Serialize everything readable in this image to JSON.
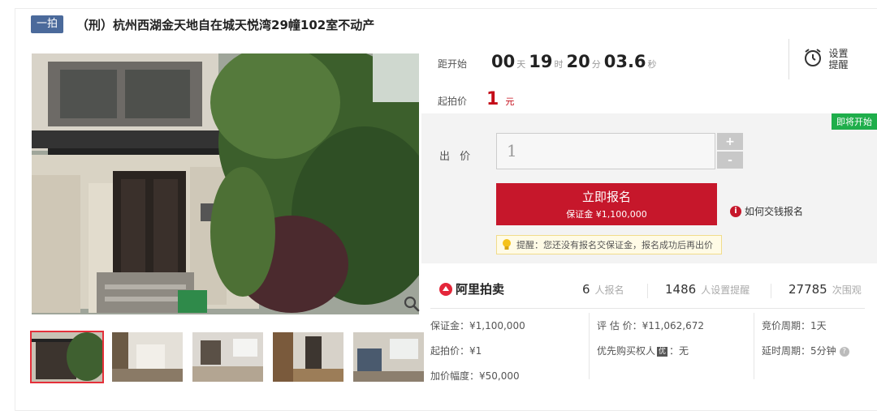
{
  "header": {
    "round_badge": "一拍",
    "title": "（刑）杭州西湖金天地自在城天悦湾29幢102室不动产"
  },
  "countdown": {
    "label": "距开始",
    "days": "00",
    "days_unit": "天",
    "hours": "19",
    "hours_unit": "时",
    "minutes": "20",
    "minutes_unit": "分",
    "seconds": "03.6",
    "seconds_unit": "秒"
  },
  "start_price": {
    "label": "起拍价",
    "value": "1",
    "unit": "元"
  },
  "reminder": {
    "line1": "设置",
    "line2": "提醒"
  },
  "bid": {
    "status_badge": "即将开始",
    "label": "出 价",
    "input_value": "1",
    "plus": "+",
    "minus": "-",
    "signup_label": "立即报名",
    "deposit_line": "保证金 ¥1,100,000",
    "howto_label": "如何交钱报名",
    "tip": "提醒：您还没有报名交保证金，报名成功后再出价"
  },
  "stats": {
    "logo_text": "阿里拍卖",
    "signups": "6",
    "signups_unit": "人报名",
    "reminders": "1486",
    "reminders_unit": "人设置提醒",
    "views": "27785",
    "views_unit": "次围观"
  },
  "details": {
    "col1": [
      "保证金：¥1,100,000",
      "起拍价：¥1",
      "加价幅度：¥50,000"
    ],
    "col2_appraisal": "评 估 价：¥11,062,672",
    "col2_priority_label": "优先购买权人",
    "col2_priority_badge": "优",
    "col2_priority_value": "：无",
    "col3": [
      "竞价周期：1天",
      "延时周期：5分钟"
    ]
  },
  "colors": {
    "accent": "#c6172b",
    "badge_blue": "#4b6a9b",
    "soon_green": "#1fae4b"
  }
}
